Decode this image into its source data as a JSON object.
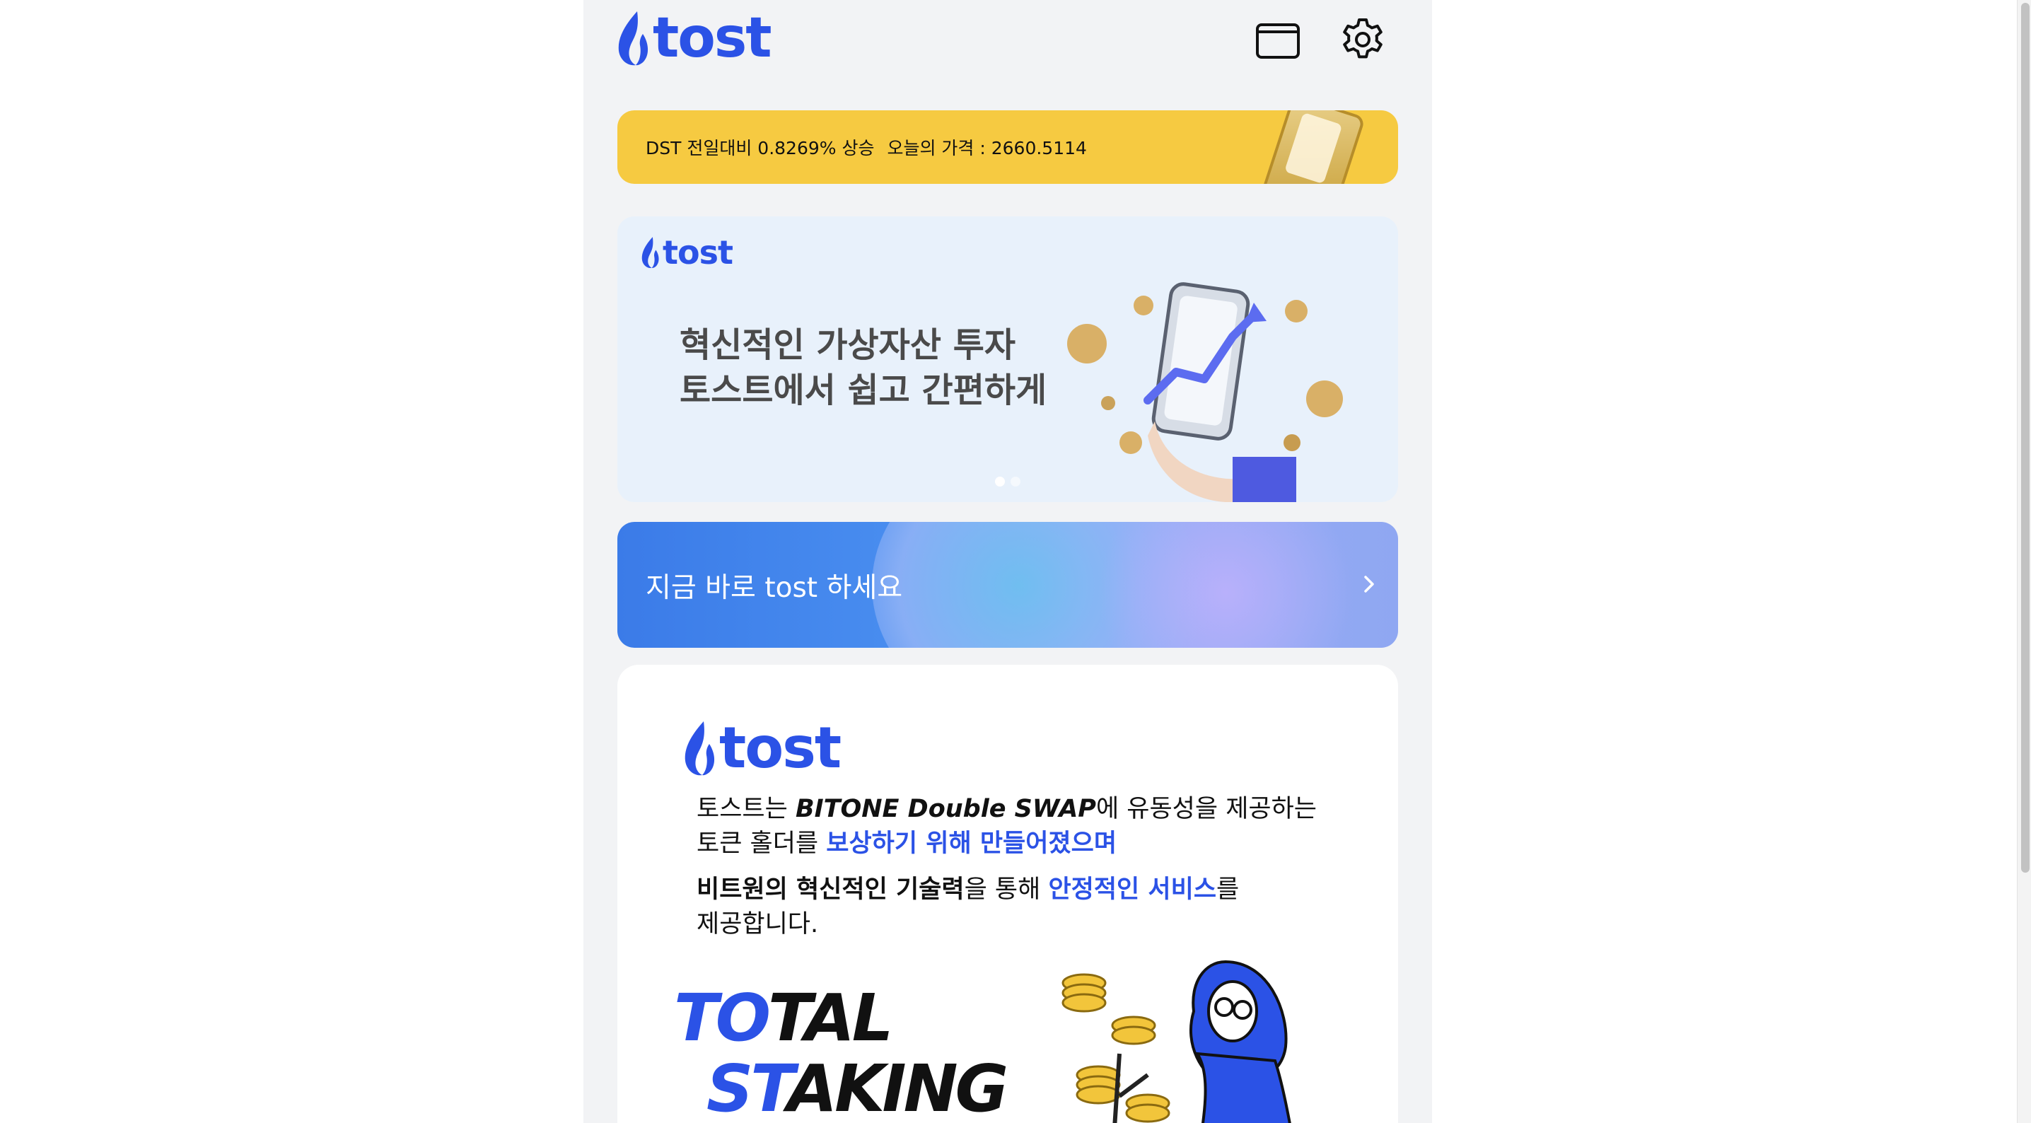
{
  "header": {
    "brand": "tost",
    "wallet_icon": "wallet-icon",
    "settings_icon": "gear-icon"
  },
  "ticker": {
    "change_text": "DST 전일대비 0.8269% 상승",
    "price_text": "오늘의 가격 : 2660.5114"
  },
  "banner": {
    "brand": "tost",
    "title_line1": "혁신적인 가상자산 투자",
    "title_line2": "토스트에서 쉽고 간편하게",
    "slides": 2,
    "active_slide": 1
  },
  "cta": {
    "label": "지금 바로 tost 하세요",
    "arrow_icon": "chevron-right-icon"
  },
  "info": {
    "brand": "tost",
    "p1_a": "토스트는 ",
    "p1_b": "BITONE Double SWAP",
    "p1_c": "에 유동성을 제공하는",
    "p1_d": "토큰 홀더를 ",
    "p1_e": "보상하기 위해 만들어졌으며",
    "p2_a": "비트원의 혁신적인 기술력",
    "p2_b": "을 통해 ",
    "p2_c": "안정적인 서비스",
    "p2_d": "를",
    "p2_e": "제공합니다.",
    "total_1a": "TO",
    "total_1b": "TAL",
    "total_2a": "ST",
    "total_2b": "AKING"
  },
  "colors": {
    "brand_blue": "#2b52e6",
    "ticker_yellow": "#f6ca41",
    "background": "#f2f3f5"
  }
}
